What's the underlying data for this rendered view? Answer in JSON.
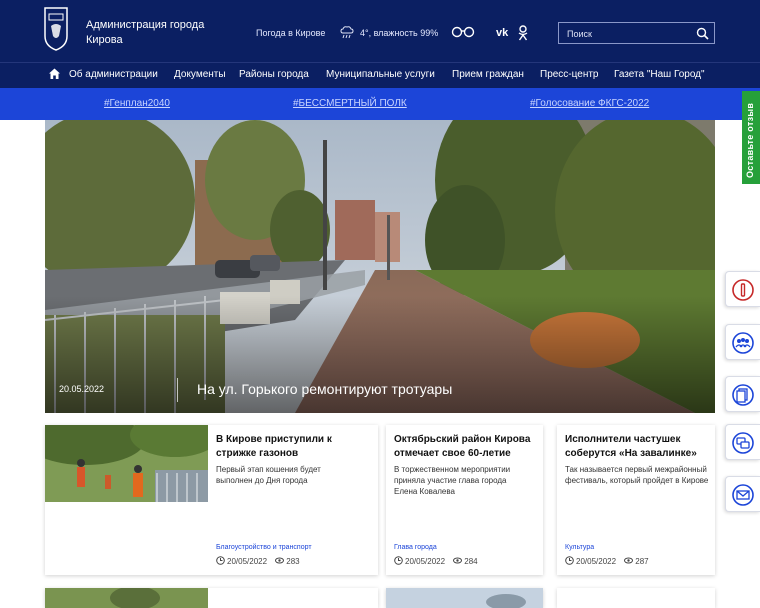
{
  "header": {
    "title": "Администрация города Кирова",
    "weather_label": "Погода в Кирове",
    "weather_text": "4°, влажность 99%",
    "search_placeholder": "Поиск"
  },
  "nav": {
    "items": [
      "Об администрации",
      "Документы",
      "Районы города",
      "Муниципальные услуги",
      "Прием граждан",
      "Пресс-центр",
      "Газета \"Наш Город\""
    ]
  },
  "tags": [
    "#Генплан2040",
    "#БЕССМЕРТНЫЙ ПОЛК",
    "#Голосование ФКГС-2022"
  ],
  "feedback_tab": "Оставьте отзыв",
  "hero": {
    "date": "20.05.2022",
    "title": "На ул. Горького ремонтируют тротуары"
  },
  "cards": [
    {
      "title": "В Кирове приступили к стрижке газонов",
      "text": "Первый этап кошения будет выполнен до Дня города",
      "category": "Благоустройство и транспорт",
      "date": "20/05/2022",
      "views": "283"
    },
    {
      "title": "Октябрьский район Кирова отмечает свое 60-летие",
      "text": "В торжественном мероприятии приняла участие глава города Елена Ковалева",
      "category": "Глава города",
      "date": "20/05/2022",
      "views": "284"
    },
    {
      "title": "Исполнители частушек соберутся «На завалинке»",
      "text": "Так называется первый межрайонный фестиваль, который пройдет в Кирове",
      "category": "Культура",
      "date": "20/05/2022",
      "views": "287"
    }
  ],
  "colors": {
    "header_bg": "#0b1f62",
    "tagbar_bg": "#1c45d8",
    "feedback_green": "#26a03a",
    "accent_red": "#c62828"
  },
  "icons": {
    "crest": "city-crest-icon",
    "weather": "cloud-rain-icon",
    "accessibility": "glasses-icon",
    "vk": "vk-icon",
    "ok": "odnoklassniki-icon",
    "search": "search-icon",
    "home": "home-icon",
    "side": [
      "alert-icon",
      "people-icon",
      "document-icon",
      "chat-icon",
      "mail-icon"
    ]
  }
}
